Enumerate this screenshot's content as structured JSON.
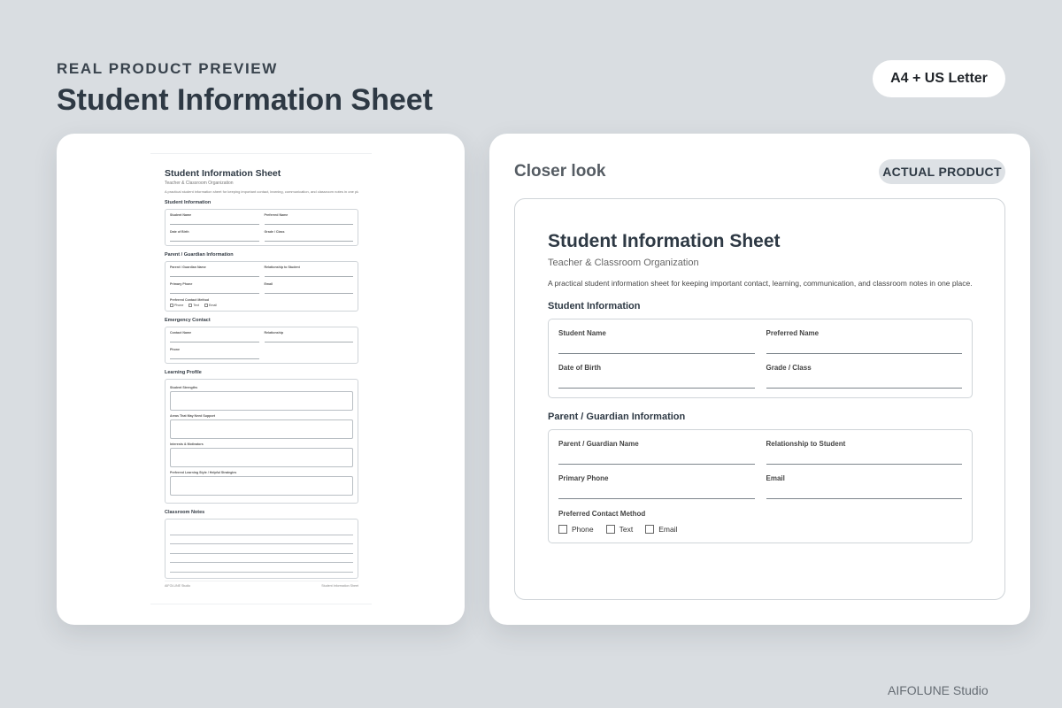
{
  "header": {
    "eyebrow": "REAL PRODUCT PREVIEW",
    "title": "Student Information Sheet",
    "format_badge": "A4 + US Letter"
  },
  "preview_page": {
    "title": "Student Information Sheet",
    "subtitle": "Teacher & Classroom Organization",
    "description": "A practical student information sheet for keeping important contact, learning, communication, and classroom notes in one place.",
    "student_section": {
      "heading": "Student Information",
      "fields": [
        "Student Name",
        "Preferred Name",
        "Date of Birth",
        "Grade / Class"
      ]
    },
    "guardian_section": {
      "heading": "Parent / Guardian Information",
      "fields": [
        "Parent / Guardian Name",
        "Relationship to Student",
        "Primary Phone",
        "Email"
      ],
      "method_label": "Preferred Contact Method",
      "methods": [
        "Phone",
        "Text",
        "Email"
      ]
    },
    "emergency_section": {
      "heading": "Emergency Contact",
      "fields": [
        "Contact Name",
        "Relationship",
        "Phone"
      ]
    },
    "learning_section": {
      "heading": "Learning Profile",
      "fields": [
        "Student Strengths",
        "Areas That May Need Support",
        "Interests & Motivators",
        "Preferred Learning Style / Helpful Strategies"
      ]
    },
    "notes_section": {
      "heading": "Classroom Notes"
    },
    "footer": {
      "left": "AIFOLUNE Studio",
      "right": "Student Information Sheet"
    }
  },
  "closer_look": {
    "title": "Closer look",
    "badge": "ACTUAL PRODUCT"
  },
  "brand": "AIFOLUNE Studio"
}
